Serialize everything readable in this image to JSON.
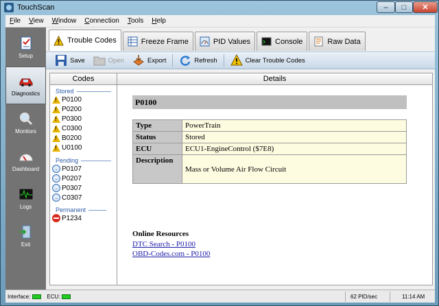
{
  "window": {
    "title": "TouchScan",
    "min": "–",
    "max": "□",
    "close": "✕"
  },
  "menu": [
    {
      "label": "File",
      "key": "F",
      "rest": "ile"
    },
    {
      "label": "View",
      "key": "V",
      "rest": "iew"
    },
    {
      "label": "Window",
      "key": "W",
      "rest": "indow"
    },
    {
      "label": "Connection",
      "key": "C",
      "rest": "onnection"
    },
    {
      "label": "Tools",
      "key": "T",
      "rest": "ools"
    },
    {
      "label": "Help",
      "key": "H",
      "rest": "elp"
    }
  ],
  "sidebar": {
    "items": [
      {
        "label": "Setup",
        "icon": "checklist-icon"
      },
      {
        "label": "Diagnostics",
        "icon": "car-icon"
      },
      {
        "label": "Monitors",
        "icon": "magnifier-icon"
      },
      {
        "label": "Dashboard",
        "icon": "gauge-icon"
      },
      {
        "label": "Logs",
        "icon": "waveform-icon"
      },
      {
        "label": "Exit",
        "icon": "exit-icon"
      }
    ],
    "active": "Diagnostics"
  },
  "tabs": [
    {
      "label": "Trouble Codes",
      "icon": "warning-icon",
      "active": true
    },
    {
      "label": "Freeze Frame",
      "icon": "grid-icon",
      "active": false
    },
    {
      "label": "PID Values",
      "icon": "gauge-icon",
      "active": false
    },
    {
      "label": "Console",
      "icon": "terminal-icon",
      "active": false
    },
    {
      "label": "Raw Data",
      "icon": "document-icon",
      "active": false
    }
  ],
  "toolbar": {
    "save": "Save",
    "open": "Open",
    "export": "Export",
    "refresh": "Refresh",
    "clear": "Clear Trouble Codes"
  },
  "codes": {
    "header": "Codes",
    "stored_label": "Stored",
    "stored": [
      "P0100",
      "P0200",
      "P0300",
      "C0300",
      "B0200",
      "U0100"
    ],
    "pending_label": "Pending",
    "pending": [
      "P0107",
      "P0207",
      "P0307",
      "C0307"
    ],
    "permanent_label": "Permanent",
    "permanent": [
      "P1234"
    ]
  },
  "details": {
    "header": "Details",
    "code": "P0100",
    "rows": [
      {
        "key": "Type",
        "value": "PowerTrain"
      },
      {
        "key": "Status",
        "value": "Stored"
      },
      {
        "key": "ECU",
        "value": "ECU1-EngineControl ($7E8)"
      },
      {
        "key": "Description",
        "value": "Mass or Volume Air Flow Circuit"
      }
    ],
    "resources_title": "Online Resources",
    "links": [
      "DTC Search - P0100",
      "OBD-Codes.com - P0100"
    ]
  },
  "status": {
    "interface_label": "Interface:",
    "ecu_label": "ECU:",
    "rate": "62 PID/sec",
    "time": "11:14 AM",
    "led_color": "#22cc22"
  }
}
